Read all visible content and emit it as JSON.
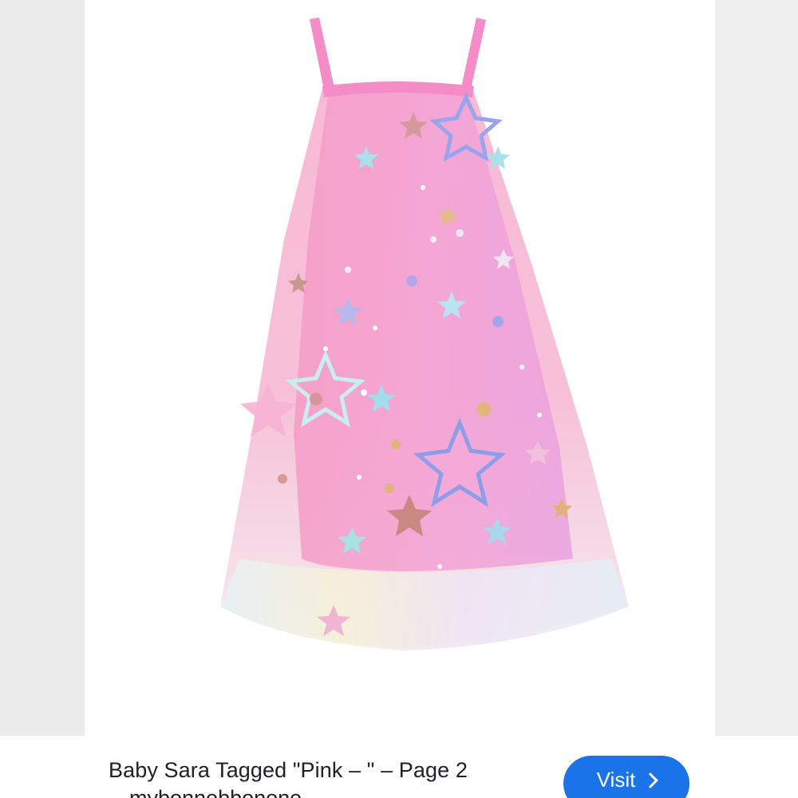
{
  "result": {
    "title": "Baby Sara Tagged \"Pink – \" – Page 2",
    "source": "mybonnebbonone"
  },
  "visit_button": {
    "label": "Visit",
    "icon": "chevron-right-icon",
    "color": "#1a73e8"
  },
  "image": {
    "subject": "pink tulle dress with sequin stars",
    "colors": {
      "dress_pink": "#f7a8cf",
      "tulle": "#fbe0ec",
      "strap": "#f48cc8"
    }
  }
}
